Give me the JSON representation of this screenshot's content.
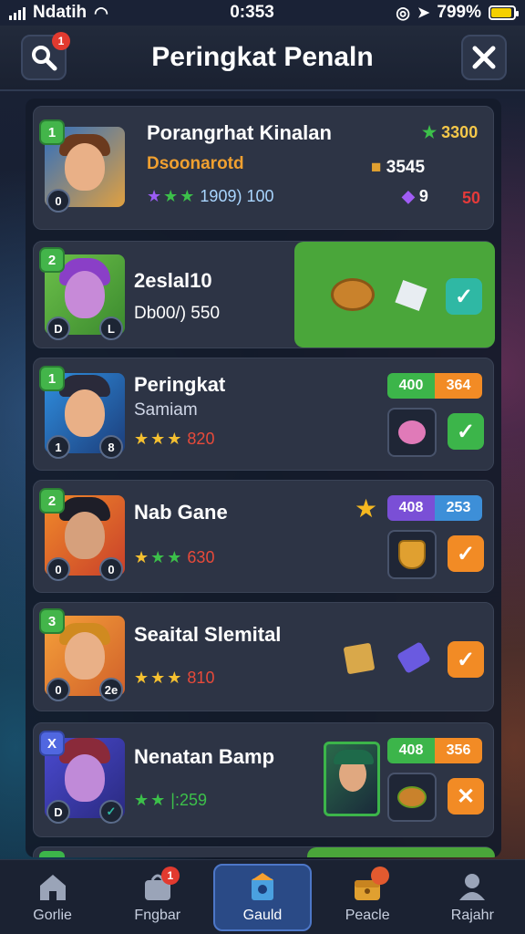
{
  "status_bar": {
    "carrier": "Ndatih",
    "time": "0:353",
    "battery": "799%"
  },
  "header": {
    "title": "Peringkat Penaln",
    "search_badge": "1"
  },
  "cards": [
    {
      "rank": "1",
      "name": "Porangrhat Kinalan",
      "subtitle": "Dsoonarotd",
      "stars_text": "1909) 100",
      "score_star": "3300",
      "gold": "3545",
      "gem": "9",
      "red": "50",
      "mini_left": "0"
    },
    {
      "rank": "2",
      "name": "2eslal10",
      "subtitle": "Db00/) 550",
      "mini_left": "D",
      "mini_right": "L"
    },
    {
      "rank": "1",
      "name": "Peringkat",
      "subtitle": "Samiam",
      "stars_text": "820",
      "pill_left": "400",
      "pill_right": "364",
      "mini_left": "1",
      "mini_right": "8"
    },
    {
      "rank": "2",
      "name": "Nab Gane",
      "stars_text": "630",
      "pill_left": "408",
      "pill_right": "253",
      "mini_left": "0",
      "mini_right": "0"
    },
    {
      "rank": "3",
      "name": "Seaital Slemital",
      "stars_text": "810",
      "mini_left": "0",
      "mini_right": "2e"
    },
    {
      "rank": "X",
      "name": "Nenatan Bamp",
      "stars_text": "|:259",
      "pill_left": "408",
      "pill_right": "356",
      "mini_left": "D"
    }
  ],
  "tabs": [
    {
      "label": "Gorlie"
    },
    {
      "label": "Fngbar",
      "badge": "1"
    },
    {
      "label": "Gauld"
    },
    {
      "label": "Peacle"
    },
    {
      "label": "Rajahr"
    }
  ],
  "colors": {
    "green": "#3cb54a",
    "orange": "#f28b25",
    "purple": "#7a4fd6",
    "blue_tab": "#2a4a86"
  }
}
